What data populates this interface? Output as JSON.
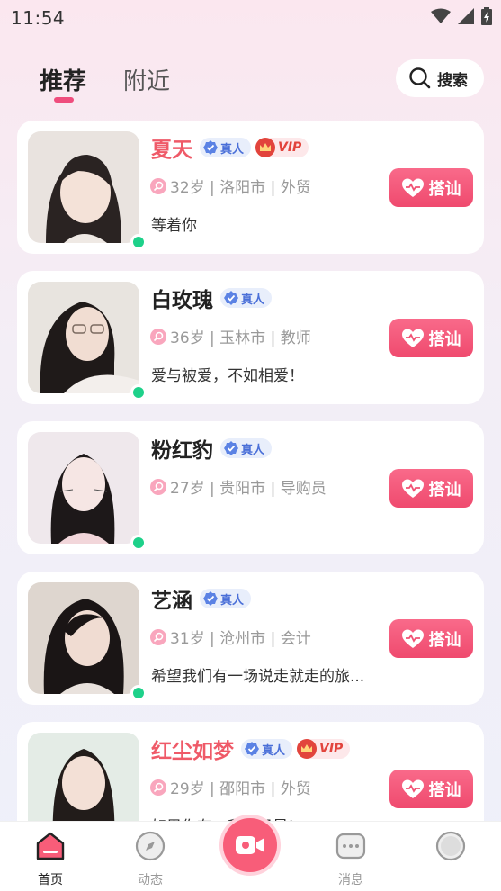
{
  "status_bar": {
    "time": "11:54"
  },
  "top_nav": {
    "tabs": [
      {
        "label": "推荐",
        "active": true
      },
      {
        "label": "附近",
        "active": false
      }
    ],
    "search_label": "搜索"
  },
  "colors": {
    "accent": "#ef4d7d",
    "online": "#1ed18a",
    "vip_name": "#ef5a68",
    "real_badge": "#4a6fd8"
  },
  "cards": [
    {
      "name": "夏天",
      "real_label": "真人",
      "vip": true,
      "vip_label": "VIP",
      "info": "32岁 | 洛阳市 | 外贸",
      "bio": "等着你",
      "button_label": "搭讪",
      "online": true
    },
    {
      "name": "白玫瑰",
      "real_label": "真人",
      "vip": false,
      "info": "36岁 | 玉林市 | 教师",
      "bio": "爱与被爱，不如相爱！",
      "button_label": "搭讪",
      "online": true
    },
    {
      "name": "粉红豹",
      "real_label": "真人",
      "vip": false,
      "info": "27岁 | 贵阳市 | 导购员",
      "bio": "",
      "button_label": "搭讪",
      "online": true
    },
    {
      "name": "艺涵",
      "real_label": "真人",
      "vip": false,
      "info": "31岁 | 沧州市 | 会计",
      "bio": "希望我们有一场说走就走的旅...",
      "button_label": "搭讪",
      "online": true
    },
    {
      "name": "红尘如梦",
      "real_label": "真人",
      "vip": true,
      "vip_label": "VIP",
      "info": "29岁 | 邵阳市 | 外贸",
      "bio": "如果你有...我的目是!",
      "button_label": "搭讪",
      "online": false
    }
  ],
  "bottom_nav": {
    "items": [
      {
        "label": "首页",
        "active": true,
        "icon": "home-icon"
      },
      {
        "label": "动态",
        "active": false,
        "icon": "compass-icon"
      },
      {
        "label": "",
        "active": false,
        "icon": "video-camera-icon"
      },
      {
        "label": "消息",
        "active": false,
        "icon": "message-icon"
      },
      {
        "label": "",
        "active": false,
        "icon": "profile-icon"
      }
    ]
  }
}
